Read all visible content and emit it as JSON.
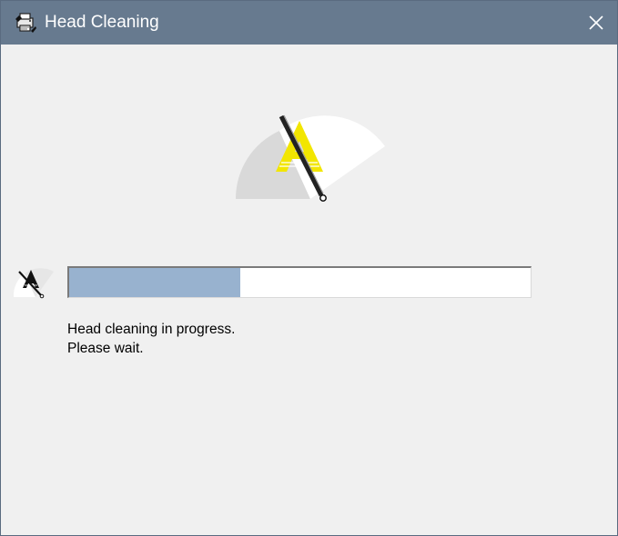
{
  "window": {
    "title": "Head Cleaning",
    "title_icon": "printer-icon",
    "close_icon": "close-icon",
    "titlebar_color": "#677a8f",
    "background_color": "#f0f0f0"
  },
  "illustration": {
    "icon": "wiper-gauge-icon",
    "accent_color": "#f2e600"
  },
  "progress": {
    "icon": "head-cleaning-icon",
    "fraction": 0.37,
    "fill_color": "#98b2cf"
  },
  "status": {
    "line1": "Head cleaning in progress.",
    "line2": "Please wait."
  }
}
